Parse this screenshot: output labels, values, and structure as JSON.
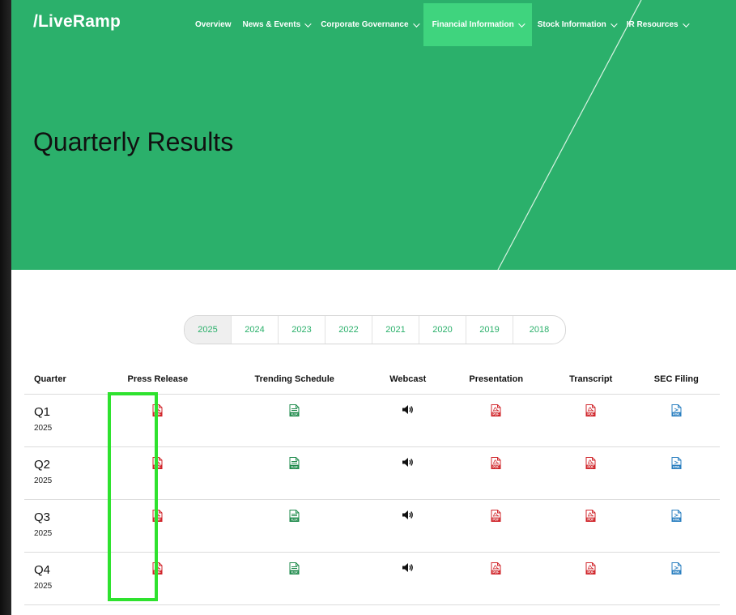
{
  "header": {
    "logo": "/LiveRamp",
    "nav": [
      {
        "label": "Overview",
        "chevron": false,
        "active": false
      },
      {
        "label": "News & Events",
        "chevron": true,
        "active": false
      },
      {
        "label": "Corporate Governance",
        "chevron": true,
        "active": false
      },
      {
        "label": "Financial Information",
        "chevron": true,
        "active": true
      },
      {
        "label": "Stock Information",
        "chevron": true,
        "active": false
      },
      {
        "label": "IR Resources",
        "chevron": true,
        "active": false
      }
    ]
  },
  "hero": {
    "title": "Quarterly Results"
  },
  "year_tabs": [
    "2025",
    "2024",
    "2023",
    "2022",
    "2021",
    "2020",
    "2019",
    "2018"
  ],
  "active_year": "2025",
  "table": {
    "columns": [
      "Quarter",
      "Press Release",
      "Trending Schedule",
      "Webcast",
      "Presentation",
      "Transcript",
      "SEC Filing"
    ],
    "rows": [
      {
        "quarter": "Q1",
        "year": "2025"
      },
      {
        "quarter": "Q2",
        "year": "2025"
      },
      {
        "quarter": "Q3",
        "year": "2025"
      },
      {
        "quarter": "Q4",
        "year": "2025"
      }
    ],
    "cell_icons": [
      "pdf-icon",
      "xlsx-icon",
      "speaker-icon",
      "pdf-icon",
      "pdf-icon",
      "html-icon"
    ]
  },
  "icon_labels": {
    "pdf": "PDF",
    "xlsx": "XLSX",
    "html": "HTML"
  },
  "colors": {
    "brand_green": "#2bb06b",
    "active_nav": "#3fd47e",
    "highlight": "#2ee22e",
    "pdf_red": "#d0262b",
    "xlsx_green": "#1f8b4c",
    "html_blue": "#2a7fc0"
  }
}
